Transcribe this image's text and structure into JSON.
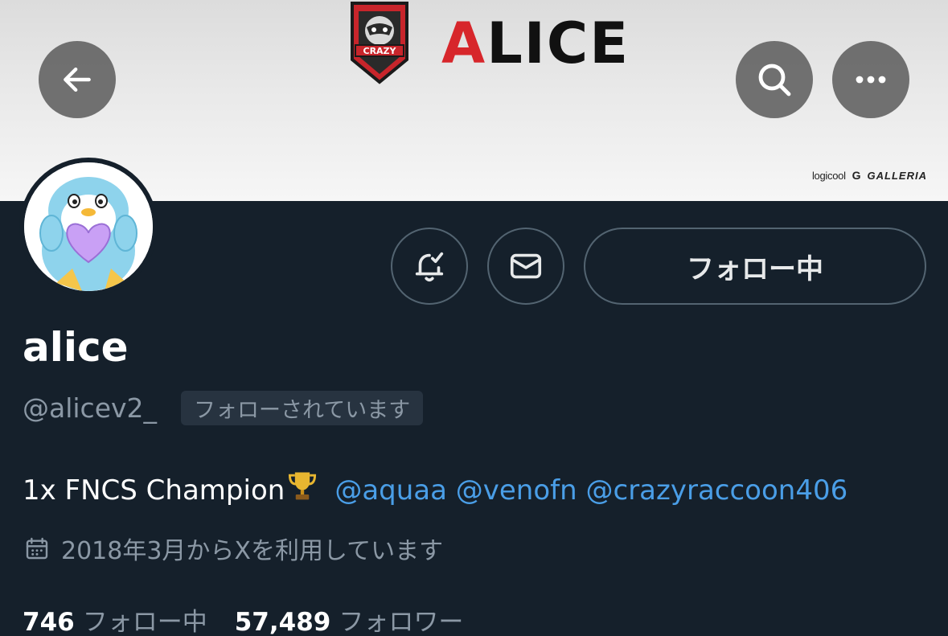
{
  "banner": {
    "title": "ALICE",
    "badge_text": "CRAZY",
    "sponsors": [
      "logicool",
      "G",
      "GALLERIA"
    ]
  },
  "header": {
    "back_icon": "arrow-left-icon",
    "search_icon": "search-icon",
    "more_icon": "more-horizontal-icon"
  },
  "profile": {
    "name": "alice",
    "handle": "@alicev2_",
    "follows_you_label": "フォローされています",
    "bio_text": "1x FNCS Champion",
    "bio_mentions": [
      "@aquaa",
      "@venofn",
      "@crazyraccoon406"
    ],
    "joined": "2018年3月からXを利用しています",
    "following_count": "746",
    "following_label": "フォロー中",
    "followers_count": "57,489",
    "followers_label": "フォロワー"
  },
  "actions": {
    "notify_icon": "bell-check-icon",
    "message_icon": "mail-icon",
    "follow_label": "フォロー中"
  },
  "colors": {
    "background": "#15202b",
    "link": "#4a9ee7",
    "muted": "#8b98a5",
    "brand_red": "#d7262b"
  }
}
